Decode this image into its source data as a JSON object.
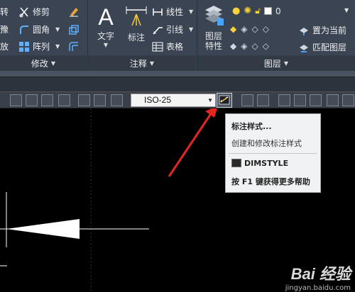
{
  "ribbon": {
    "modify": {
      "rotate_label": "转",
      "trim_label": "修剪",
      "move_label": "豫",
      "fillet_label": "圆角",
      "scale_label": "放",
      "array_label": "阵列",
      "panel_label": "修改"
    },
    "annotation": {
      "text_label": "文字",
      "dimension_label": "标注",
      "linear_label": "线性",
      "leader_label": "引线",
      "table_label": "表格",
      "panel_label": "注释"
    },
    "layers": {
      "layer_properties_label": "图层\n特性",
      "current_layer_value": "0",
      "set_current_label": "置为当前",
      "match_layer_label": "匹配图层",
      "panel_label": "图层"
    }
  },
  "toolbar": {
    "dim_style_value": "ISO-25"
  },
  "tooltip": {
    "title": "标注样式...",
    "description": "创建和修改标注样式",
    "command": "DIMSTYLE",
    "help": "按 F1 键获得更多帮助"
  },
  "watermark": {
    "brand": "Bai 经验",
    "url": "jingyan.baidu.com"
  },
  "colors": {
    "ribbon_bg": "#3b4453",
    "canvas_bg": "#000000",
    "arrow_red": "#e3261e",
    "tooltip_bg": "#f1f2f3"
  }
}
